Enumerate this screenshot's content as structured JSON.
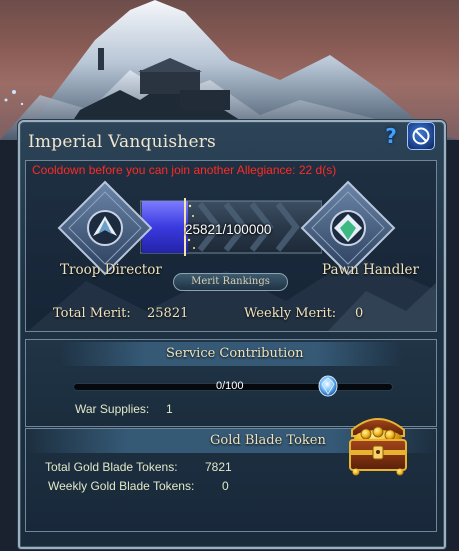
{
  "window": {
    "title": "Imperial Vanquishers",
    "help_icon": "question-mark-icon",
    "close_icon": "no-entry-icon"
  },
  "allegiance": {
    "cooldown_text": "Cooldown before you can join another Allegiance: 22 d(s)",
    "current_rank": "Troop Director",
    "next_rank": "Pawn Handler",
    "merit_progress": {
      "text": "25821/100000",
      "value": 25821,
      "max": 100000
    },
    "merit_rankings_button": "Merit Rankings",
    "total_merit_label": "Total Merit:",
    "total_merit_value": "25821",
    "weekly_merit_label": "Weekly Merit:",
    "weekly_merit_value": "0"
  },
  "service": {
    "header": "Service Contribution",
    "progress_text": "0/100",
    "progress_value": 0,
    "progress_max": 100,
    "war_supplies_label": "War Supplies:",
    "war_supplies_value": "1"
  },
  "gold_blade": {
    "header": "Gold Blade Token",
    "total_label": "Total Gold Blade Tokens:",
    "total_value": "7821",
    "weekly_label": "Weekly Gold Blade Tokens:",
    "weekly_value": "0",
    "chest_icon": "treasure-chest-icon"
  },
  "colors": {
    "title_text": "#f0e6cf",
    "cooldown_text": "#ff2a24",
    "progress_fill": "#3a3adf",
    "help_icon": "#3fa0ff"
  }
}
